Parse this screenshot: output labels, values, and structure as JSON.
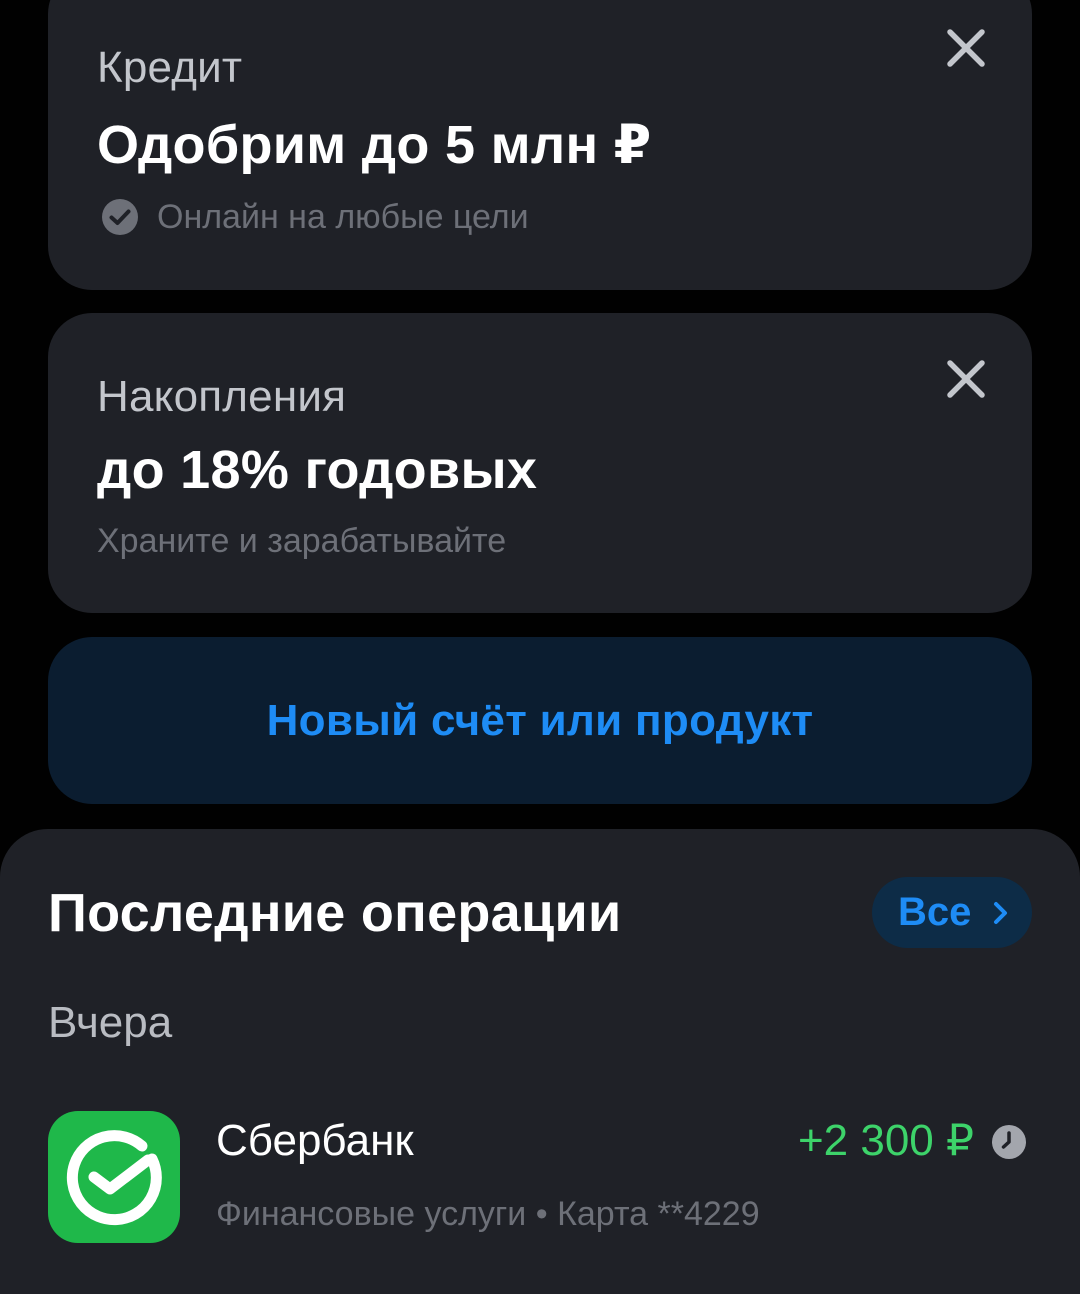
{
  "colors": {
    "background": "#010101",
    "card": "#1f2127",
    "accent_blue": "#1e8cf5",
    "income_green": "#3dd36a",
    "sber_green": "#1fb84a"
  },
  "offers": [
    {
      "eyebrow": "Кредит",
      "headline": "Одобрим до 5 млн ₽",
      "subtitle": "Онлайн на любые цели",
      "subtitle_icon": "check-circle-icon",
      "close_icon": "close-icon"
    },
    {
      "eyebrow": "Накопления",
      "headline": "до 18% годовых",
      "subtitle": "Храните и зарабатывайте",
      "close_icon": "close-icon"
    }
  ],
  "new_product": {
    "label": "Новый счёт или продукт"
  },
  "recent_operations": {
    "title": "Последние операции",
    "all_button": {
      "label": "Все",
      "icon": "chevron-right-icon"
    },
    "groups": [
      {
        "date": "Вчера",
        "items": [
          {
            "name": "Сбербанк",
            "category": "Финансовые услуги • Карта **4229",
            "amount": "+2 300 ₽",
            "logo_icon": "sberbank-logo-icon",
            "status_icon": "clock-icon"
          }
        ]
      }
    ]
  }
}
